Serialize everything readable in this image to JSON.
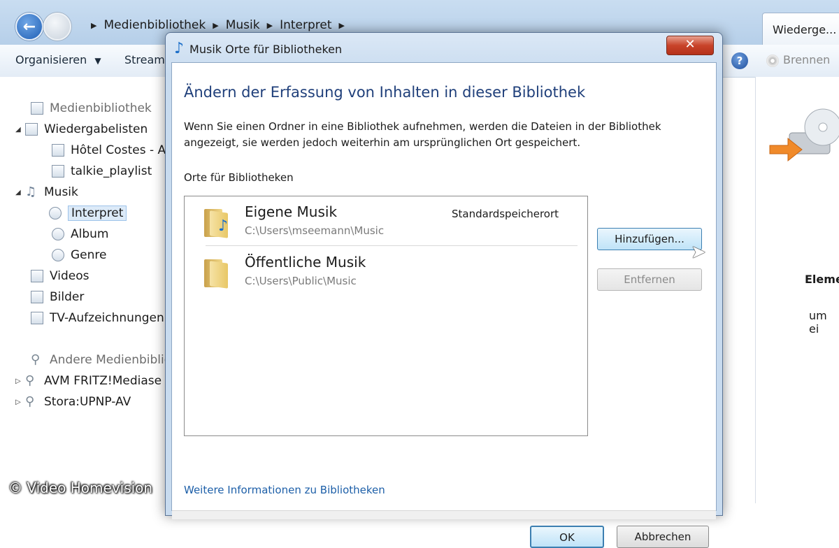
{
  "explorer": {
    "breadcrumb": [
      "Medienbibliothek",
      "Musik",
      "Interpret"
    ],
    "toolbar": {
      "organize": "Organisieren",
      "stream": "Stream",
      "burn": "Brennen"
    },
    "tab_label": "Wiederge...",
    "sidebar": {
      "library": "Medienbibliothek",
      "playlists": "Wiedergabelisten",
      "playlist_items": [
        "Hôtel Costes - A",
        "talkie_playlist"
      ],
      "music": "Musik",
      "music_items": [
        "Interpret",
        "Album",
        "Genre"
      ],
      "videos": "Videos",
      "pictures": "Bilder",
      "tv": "TV-Aufzeichnungen",
      "other_libraries": "Andere Medienbiblio",
      "devices": [
        "AVM FRITZ!Mediase",
        "Stora:UPNP-AV"
      ]
    },
    "right_panel": {
      "text1": "Eleme",
      "text2": "um ei"
    }
  },
  "dialog": {
    "title": "Musik Orte für Bibliotheken",
    "heading": "Ändern der Erfassung von Inhalten in dieser Bibliothek",
    "description": "Wenn Sie einen Ordner in eine Bibliothek aufnehmen, werden die Dateien in der Bibliothek angezeigt, sie werden jedoch weiterhin am ursprünglichen Ort gespeichert.",
    "section_label": "Orte für Bibliotheken",
    "locations": [
      {
        "name": "Eigene Musik",
        "path": "C:\\Users\\mseemann\\Music",
        "tag": "Standardspeicherort"
      },
      {
        "name": "Öffentliche Musik",
        "path": "C:\\Users\\Public\\Music",
        "tag": ""
      }
    ],
    "add_button": "Hinzufügen...",
    "remove_button": "Entfernen",
    "more_info_link": "Weitere Informationen zu Bibliotheken",
    "ok_button": "OK",
    "cancel_button": "Abbrechen"
  },
  "watermark": "© Video Homevision"
}
